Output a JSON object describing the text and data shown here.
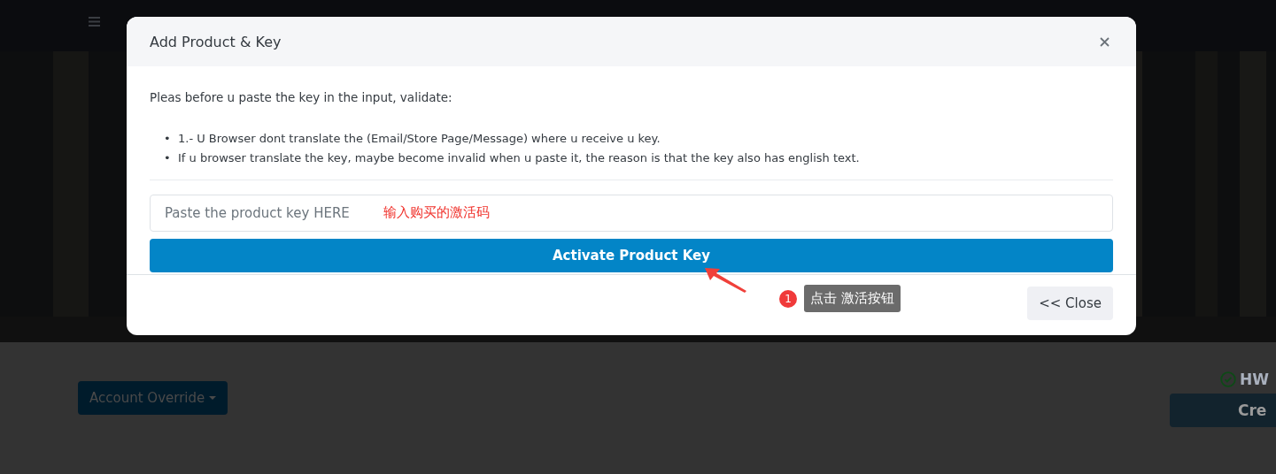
{
  "page": {
    "account_button": "Account Override",
    "status_label": "HW",
    "create_button": "Cre"
  },
  "dialog": {
    "title": "Add Product & Key",
    "intro": "Pleas before u paste the key in the input, validate:",
    "notes": [
      {
        "bullet": "•",
        "text": "1.- U Browser dont translate the (Email/Store Page/Message) where u receive u key."
      },
      {
        "bullet": "•",
        "text": "If u browser translate the key, maybe become invalid when u paste it, the reason is that the key also has english text."
      }
    ],
    "key_field": {
      "placeholder": "Paste the product key HERE"
    },
    "activate_button": "Activate Product Key",
    "close_button": "<< Close"
  },
  "annotations": {
    "field_hint": "输入购买的激活码",
    "step_number": "1",
    "step_tip": "点击 激活按钮"
  }
}
